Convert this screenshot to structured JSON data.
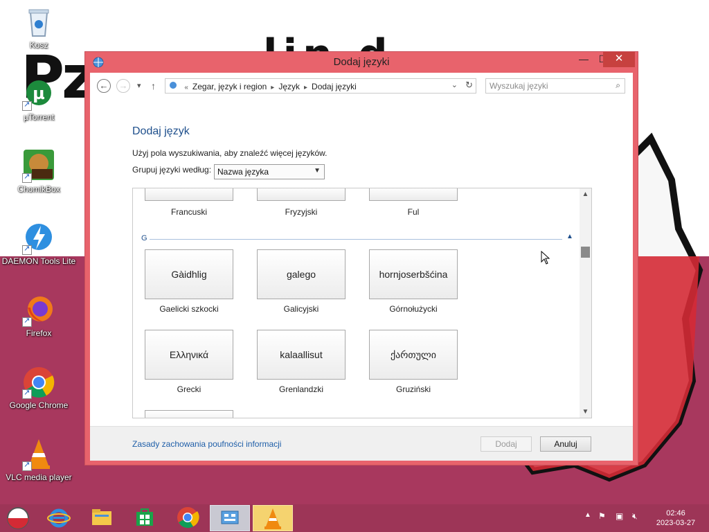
{
  "desktop": {
    "icons": [
      {
        "label": "Kosz"
      },
      {
        "label": "µTorrent"
      },
      {
        "label": "ChomikBox"
      },
      {
        "label": "DAEMON Tools Lite"
      },
      {
        "label": "Firefox"
      },
      {
        "label": "Google Chrome"
      },
      {
        "label": "VLC media player"
      }
    ]
  },
  "window": {
    "title": "Dodaj języki",
    "controls": {
      "minimize": "—",
      "maximize": "☐",
      "close": "✕"
    },
    "nav": {
      "back": "←",
      "forward": "→",
      "recent": "▾",
      "up": "↑",
      "breadcrumbs": [
        "Zegar, język i region",
        "Język",
        "Dodaj języki"
      ],
      "crumb_prefix": "«",
      "search_placeholder": "Wyszukaj języki"
    },
    "heading": "Dodaj język",
    "hint": "Użyj pola wyszukiwania, aby znaleźć więcej języków.",
    "group_label": "Grupuj języki według:",
    "group_value": "Nazwa języka",
    "top_partial": [
      "Francuski",
      "Fryzyjski",
      "Ful"
    ],
    "group_letter": "G",
    "languages": [
      {
        "native": "Gàidhlig",
        "name": "Gaelicki szkocki"
      },
      {
        "native": "galego",
        "name": "Galicyjski"
      },
      {
        "native": "hornjoserbšćina",
        "name": "Górnołużycki"
      },
      {
        "native": "Ελληνικά",
        "name": "Grecki"
      },
      {
        "native": "kalaallisut",
        "name": "Grenlandzki"
      },
      {
        "native": "ქართული",
        "name": "Gruziński"
      }
    ],
    "privacy_link": "Zasady zachowania poufności informacji",
    "add_button": "Dodaj",
    "cancel_button": "Anuluj"
  },
  "taskbar": {
    "time": "02:46",
    "date": "2023-03-27"
  },
  "colors": {
    "window_frame": "#e8636c",
    "close_button": "#c7413f",
    "heading_blue": "#1e4f8c",
    "link_blue": "#1e5ea8",
    "taskbar": "#9d3557",
    "wallpaper_red": "#a8385e"
  }
}
